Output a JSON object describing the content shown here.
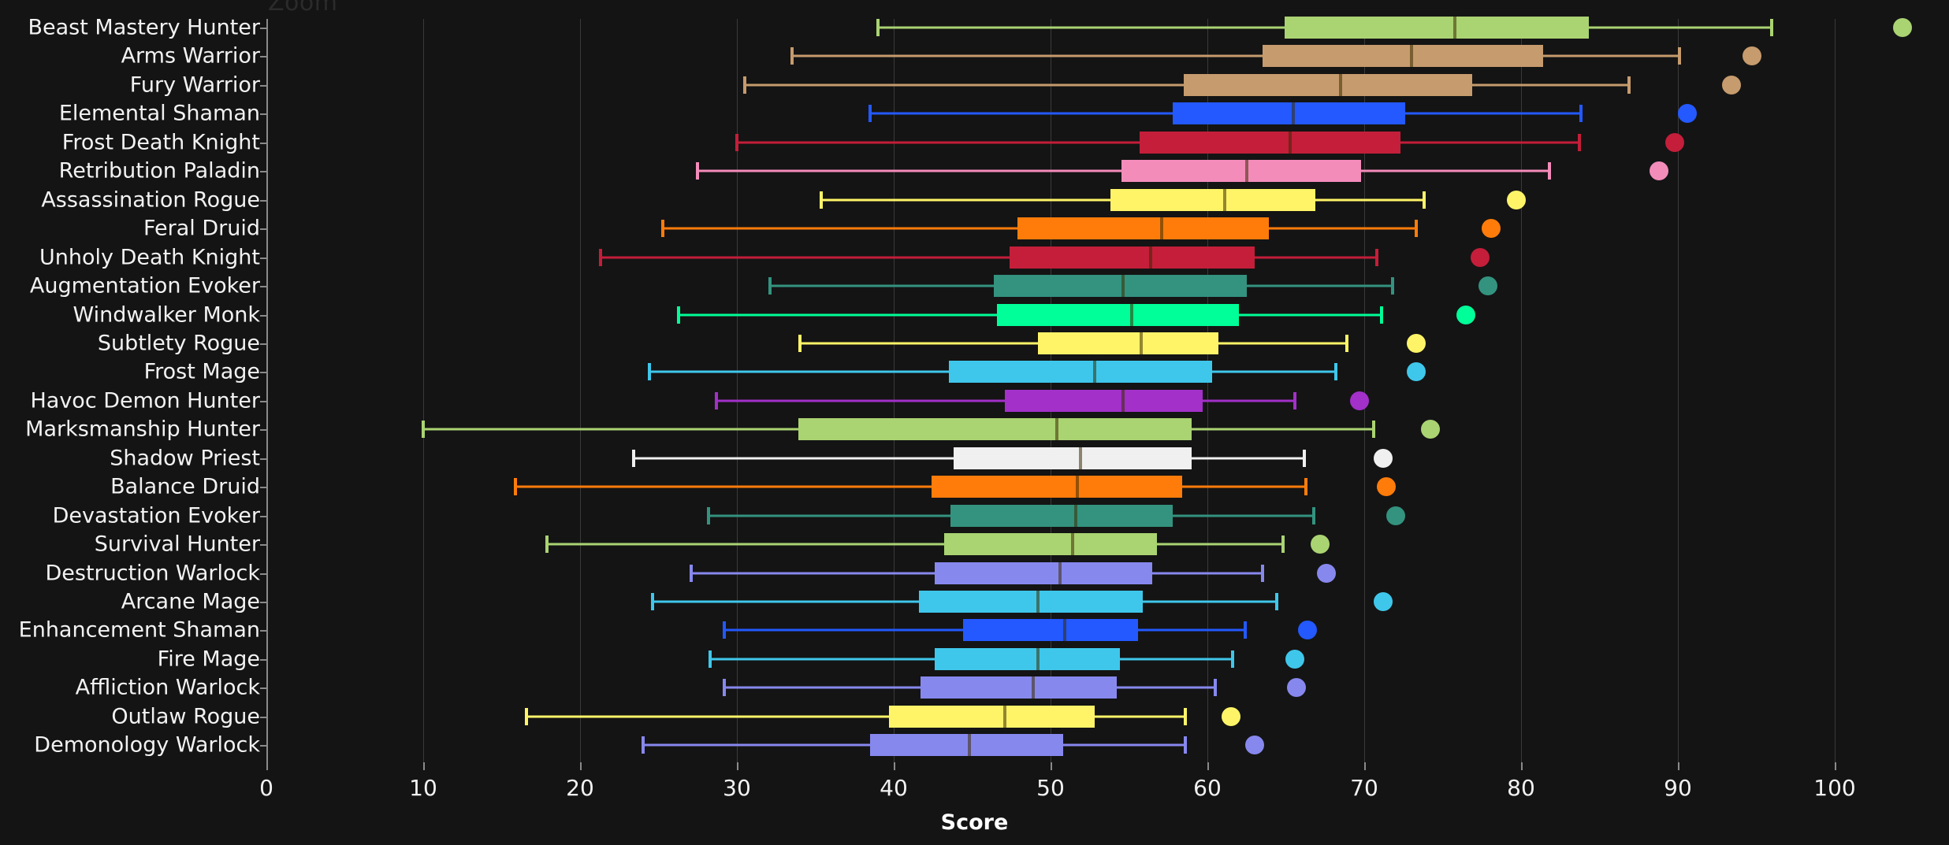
{
  "watermark": {
    "text": "Zoom"
  },
  "axis": {
    "x_title": "Score",
    "x_ticks": [
      0,
      10,
      20,
      30,
      40,
      50,
      60,
      70,
      80,
      90,
      100
    ],
    "x_min": 0,
    "x_max": 105,
    "grid": true
  },
  "chart_data": {
    "type": "boxplot",
    "title": "",
    "xlabel": "Score",
    "ylabel": "",
    "xlim": [
      0,
      105
    ],
    "x_ticks": [
      0,
      10,
      20,
      30,
      40,
      50,
      60,
      70,
      80,
      90,
      100
    ],
    "grid": true,
    "legend": "none",
    "orientation": "horizontal",
    "categories": [
      "Beast Mastery Hunter",
      "Arms Warrior",
      "Fury Warrior",
      "Elemental Shaman",
      "Frost Death Knight",
      "Retribution Paladin",
      "Assassination Rogue",
      "Feral Druid",
      "Unholy Death Knight",
      "Augmentation Evoker",
      "Windwalker Monk",
      "Subtlety Rogue",
      "Frost Mage",
      "Havoc Demon Hunter",
      "Marksmanship Hunter",
      "Shadow Priest",
      "Balance Druid",
      "Devastation Evoker",
      "Survival Hunter",
      "Destruction Warlock",
      "Arcane Mage",
      "Enhancement Shaman",
      "Fire Mage",
      "Affliction Warlock",
      "Outlaw Rogue",
      "Demonology Warlock"
    ],
    "boxes": [
      {
        "label": "Beast Mastery Hunter",
        "color": "#AAD372",
        "whisker_low": 39.0,
        "q1": 64.9,
        "median": 75.8,
        "q3": 84.3,
        "whisker_high": 96.0,
        "outlier": 104.3
      },
      {
        "label": "Arms Warrior",
        "color": "#C69B6D",
        "whisker_low": 33.5,
        "q1": 63.5,
        "median": 73.0,
        "q3": 81.4,
        "whisker_high": 90.1,
        "outlier": 94.7
      },
      {
        "label": "Fury Warrior",
        "color": "#C69B6D",
        "whisker_low": 30.5,
        "q1": 58.5,
        "median": 68.5,
        "q3": 76.9,
        "whisker_high": 86.9,
        "outlier": 93.4
      },
      {
        "label": "Elemental Shaman",
        "color": "#2359FF",
        "whisker_low": 38.5,
        "q1": 57.8,
        "median": 65.5,
        "q3": 72.6,
        "whisker_high": 83.8,
        "outlier": 90.6
      },
      {
        "label": "Frost Death Knight",
        "color": "#C41E3A",
        "whisker_low": 30.0,
        "q1": 55.7,
        "median": 65.3,
        "q3": 72.3,
        "whisker_high": 83.7,
        "outlier": 89.8
      },
      {
        "label": "Retribution Paladin",
        "color": "#F48CBA",
        "whisker_low": 27.5,
        "q1": 54.5,
        "median": 62.5,
        "q3": 69.8,
        "whisker_high": 81.8,
        "outlier": 88.8
      },
      {
        "label": "Assassination Rogue",
        "color": "#FFF468",
        "whisker_low": 35.4,
        "q1": 53.8,
        "median": 61.1,
        "q3": 66.9,
        "whisker_high": 73.8,
        "outlier": 79.7
      },
      {
        "label": "Feral Druid",
        "color": "#FF7C0A",
        "whisker_low": 25.3,
        "q1": 47.9,
        "median": 57.1,
        "q3": 63.9,
        "whisker_high": 73.3,
        "outlier": 78.1
      },
      {
        "label": "Unholy Death Knight",
        "color": "#C41E3A",
        "whisker_low": 21.3,
        "q1": 47.4,
        "median": 56.4,
        "q3": 63.0,
        "whisker_high": 70.8,
        "outlier": 77.4
      },
      {
        "label": "Augmentation Evoker",
        "color": "#33937F",
        "whisker_low": 32.1,
        "q1": 46.4,
        "median": 54.6,
        "q3": 62.5,
        "whisker_high": 71.8,
        "outlier": 77.9
      },
      {
        "label": "Windwalker Monk",
        "color": "#00FF98",
        "whisker_low": 26.3,
        "q1": 46.6,
        "median": 55.2,
        "q3": 62.0,
        "whisker_high": 71.1,
        "outlier": 76.5
      },
      {
        "label": "Subtlety Rogue",
        "color": "#FFF468",
        "whisker_low": 34.0,
        "q1": 49.2,
        "median": 55.8,
        "q3": 60.7,
        "whisker_high": 68.9,
        "outlier": 73.3
      },
      {
        "label": "Frost Mage",
        "color": "#3FC7EB",
        "whisker_low": 24.4,
        "q1": 43.5,
        "median": 52.8,
        "q3": 60.3,
        "whisker_high": 68.2,
        "outlier": 73.3
      },
      {
        "label": "Havoc Demon Hunter",
        "color": "#A330C9",
        "whisker_low": 28.7,
        "q1": 47.1,
        "median": 54.6,
        "q3": 59.7,
        "whisker_high": 65.6,
        "outlier": 69.7
      },
      {
        "label": "Marksmanship Hunter",
        "color": "#AAD372",
        "whisker_low": 10.0,
        "q1": 33.9,
        "median": 50.4,
        "q3": 59.0,
        "whisker_high": 70.6,
        "outlier": 74.2
      },
      {
        "label": "Shadow Priest",
        "color": "#F0F0F0",
        "whisker_low": 23.4,
        "q1": 43.8,
        "median": 51.9,
        "q3": 59.0,
        "whisker_high": 66.2,
        "outlier": 71.2
      },
      {
        "label": "Balance Druid",
        "color": "#FF7C0A",
        "whisker_low": 15.9,
        "q1": 42.4,
        "median": 51.7,
        "q3": 58.4,
        "whisker_high": 66.3,
        "outlier": 71.4
      },
      {
        "label": "Devastation Evoker",
        "color": "#33937F",
        "whisker_low": 28.2,
        "q1": 43.6,
        "median": 51.6,
        "q3": 57.8,
        "whisker_high": 66.8,
        "outlier": 72.0
      },
      {
        "label": "Survival Hunter",
        "color": "#AAD372",
        "whisker_low": 17.9,
        "q1": 43.2,
        "median": 51.4,
        "q3": 56.8,
        "whisker_high": 64.8,
        "outlier": 67.2
      },
      {
        "label": "Destruction Warlock",
        "color": "#8788EE",
        "whisker_low": 27.1,
        "q1": 42.6,
        "median": 50.6,
        "q3": 56.5,
        "whisker_high": 63.5,
        "outlier": 67.6
      },
      {
        "label": "Arcane Mage",
        "color": "#3FC7EB",
        "whisker_low": 24.6,
        "q1": 41.6,
        "median": 49.2,
        "q3": 55.9,
        "whisker_high": 64.4,
        "outlier": 71.2
      },
      {
        "label": "Enhancement Shaman",
        "color": "#2359FF",
        "whisker_low": 29.2,
        "q1": 44.4,
        "median": 50.9,
        "q3": 55.6,
        "whisker_high": 62.4,
        "outlier": 66.4
      },
      {
        "label": "Fire Mage",
        "color": "#3FC7EB",
        "whisker_low": 28.3,
        "q1": 42.6,
        "median": 49.2,
        "q3": 54.4,
        "whisker_high": 61.6,
        "outlier": 65.6
      },
      {
        "label": "Affliction Warlock",
        "color": "#8788EE",
        "whisker_low": 29.2,
        "q1": 41.7,
        "median": 48.9,
        "q3": 54.2,
        "whisker_high": 60.5,
        "outlier": 65.7
      },
      {
        "label": "Outlaw Rogue",
        "color": "#FFF468",
        "whisker_low": 16.6,
        "q1": 39.7,
        "median": 47.1,
        "q3": 52.8,
        "whisker_high": 58.6,
        "outlier": 61.5
      },
      {
        "label": "Demonology Warlock",
        "color": "#8788EE",
        "whisker_low": 24.0,
        "q1": 38.5,
        "median": 44.8,
        "q3": 50.8,
        "whisker_high": 58.6,
        "outlier": 63.0
      }
    ]
  }
}
